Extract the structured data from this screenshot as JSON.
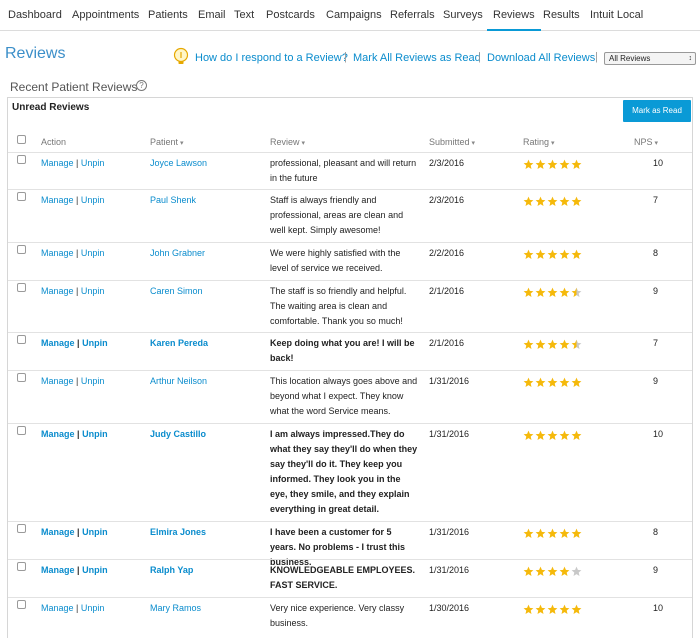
{
  "nav": {
    "tabs": [
      {
        "label": "Dashboard"
      },
      {
        "label": "Appointments"
      },
      {
        "label": "Patients"
      },
      {
        "label": "Email"
      },
      {
        "label": "Text"
      },
      {
        "label": "Postcards"
      },
      {
        "label": "Campaigns"
      },
      {
        "label": "Referrals"
      },
      {
        "label": "Surveys"
      },
      {
        "label": "Reviews",
        "active": true
      },
      {
        "label": "Results"
      },
      {
        "label": "Intuit Local"
      }
    ]
  },
  "page": {
    "title": "Reviews",
    "help_link": "How do I respond to a Review?",
    "mark_all_link": "Mark All Reviews as Read",
    "download_link": "Download All Reviews",
    "separator": "|",
    "filter_selected": "All Reviews",
    "section_title": "Recent Patient Reviews",
    "help_glyph": "?"
  },
  "panel": {
    "title": "Unread Reviews",
    "mark_read_label": "Mark as Read"
  },
  "table": {
    "columns": {
      "action": "Action",
      "patient": "Patient",
      "review": "Review",
      "submitted": "Submitted",
      "rating": "Rating",
      "nps": "NPS"
    },
    "manage_label": "Manage",
    "unpin_label": "Unpin",
    "action_separator": "|",
    "rows": [
      {
        "patient": "Joyce Lawson",
        "review": "professional, pleasant and will return in the future",
        "submitted": "2/3/2016",
        "rating": 5,
        "nps": "10",
        "unread": false
      },
      {
        "patient": "Paul Shenk",
        "review": "Staff is always friendly and professional, areas are clean and well kept. Simply awesome!",
        "submitted": "2/3/2016",
        "rating": 5,
        "nps": "7",
        "unread": false
      },
      {
        "patient": "John Grabner",
        "review": "We were highly satisfied with the level of service we received.",
        "submitted": "2/2/2016",
        "rating": 5,
        "nps": "8",
        "unread": false
      },
      {
        "patient": "Caren Simon",
        "review": "The staff is so friendly and helpful. The waiting area is clean and comfortable. Thank you so much!",
        "submitted": "2/1/2016",
        "rating": 4.5,
        "nps": "9",
        "unread": false
      },
      {
        "patient": "Karen Pereda",
        "review": "Keep doing what you are! I will be back!",
        "submitted": "2/1/2016",
        "rating": 4.5,
        "nps": "7",
        "unread": true
      },
      {
        "patient": "Arthur Neilson",
        "review": "This location always goes above and beyond what I expect. They know what the word Service means.",
        "submitted": "1/31/2016",
        "rating": 5,
        "nps": "9",
        "unread": false
      },
      {
        "patient": "Judy Castillo",
        "review": "I am always impressed.They do what they say they'll do when they say they'll do it. They keep you informed. They look you in the eye, they smile, and they explain everything in great detail.",
        "submitted": "1/31/2016",
        "rating": 5,
        "nps": "10",
        "unread": true
      },
      {
        "patient": "Elmira Jones",
        "review": "I have been a customer for 5 years. No problems - I trust this business.",
        "submitted": "1/31/2016",
        "rating": 5,
        "nps": "8",
        "unread": true
      },
      {
        "patient": "Ralph Yap",
        "review": "KNOWLEDGEABLE EMPLOYEES. FAST SERVICE.",
        "submitted": "1/31/2016",
        "rating": 4,
        "nps": "9",
        "unread": true
      },
      {
        "patient": "Mary Ramos",
        "review": "Very nice experience. Very classy business.",
        "submitted": "1/30/2016",
        "rating": 5,
        "nps": "10",
        "unread": false
      }
    ]
  },
  "colors": {
    "accent": "#0a9ad6",
    "link": "#0a8ccd",
    "star": "#f5b90b",
    "star_empty": "#c8c8c8"
  },
  "icons": {
    "help_bulb": "lightbulb-icon",
    "question": "question-circle-icon",
    "sort": "caret-down-icon",
    "select_arrow": "select-arrows-icon"
  }
}
